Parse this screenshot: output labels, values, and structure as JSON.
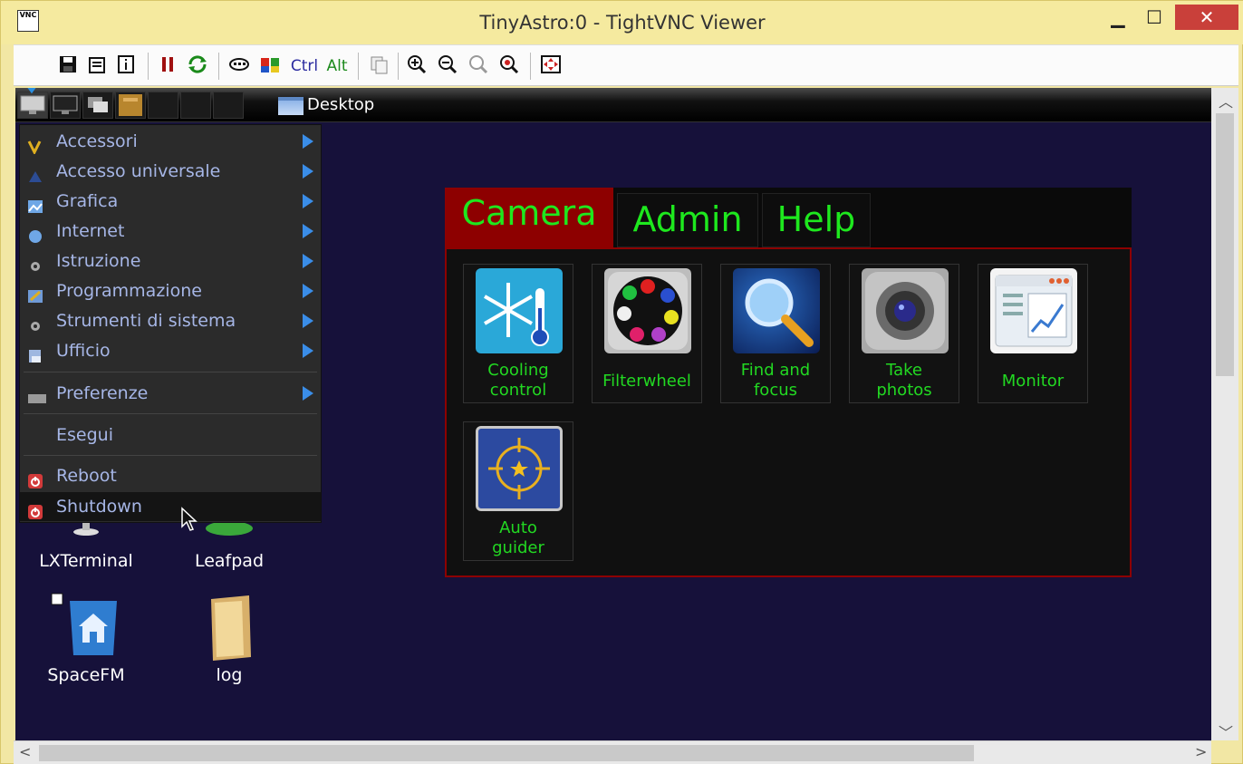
{
  "window": {
    "title": "TinyAstro:0 - TightVNC Viewer",
    "app_icon_text": "VNC",
    "minimize": "▁",
    "maximize": "☐",
    "close": "✕"
  },
  "toolbar": {
    "ctrl": "Ctrl",
    "alt": "Alt"
  },
  "panel": {
    "desktop_label": "Desktop"
  },
  "menu": {
    "items": [
      {
        "label": "Accessori",
        "icon": "accessories-icon",
        "color": "#e0b020",
        "submenu": true
      },
      {
        "label": "Accesso universale",
        "icon": "accessibility-icon",
        "color": "#4c72c4",
        "submenu": true
      },
      {
        "label": "Grafica",
        "icon": "graphics-icon",
        "color": "#6fa7e6",
        "submenu": true
      },
      {
        "label": "Internet",
        "icon": "internet-icon",
        "color": "#6fa7e6",
        "submenu": true
      },
      {
        "label": "Istruzione",
        "icon": "education-icon",
        "color": "#aaaaaa",
        "submenu": true
      },
      {
        "label": "Programmazione",
        "icon": "programming-icon",
        "color": "#6f9ad6",
        "submenu": true
      },
      {
        "label": "Strumenti di sistema",
        "icon": "system-tools-icon",
        "color": "#aaaaaa",
        "submenu": true
      },
      {
        "label": "Ufficio",
        "icon": "office-icon",
        "color": "#9fb7e0",
        "submenu": true
      },
      {
        "label": "Preferenze",
        "icon": "preferences-icon",
        "color": "#9a9a9a",
        "submenu": true
      },
      {
        "label": "Esegui",
        "icon": "",
        "color": "",
        "submenu": false
      },
      {
        "label": "Reboot",
        "icon": "power-icon",
        "color": "#d23a3a",
        "submenu": false
      },
      {
        "label": "Shutdown",
        "icon": "power-icon",
        "color": "#d23a3a",
        "submenu": false
      }
    ]
  },
  "desktop_icons": [
    {
      "label": "LXTerminal"
    },
    {
      "label": "Leafpad"
    },
    {
      "label": "SpaceFM"
    },
    {
      "label": "log"
    }
  ],
  "app": {
    "tabs": [
      "Camera",
      "Admin",
      "Help"
    ],
    "active_tab": "Camera",
    "tiles": [
      {
        "line1": "Cooling",
        "line2": "control",
        "icon": "snowflake-thermometer-icon"
      },
      {
        "line1": "Filterwheel",
        "line2": "",
        "icon": "filterwheel-icon"
      },
      {
        "line1": "Find and",
        "line2": "focus",
        "icon": "magnifier-icon"
      },
      {
        "line1": "Take",
        "line2": "photos",
        "icon": "camera-lens-icon"
      },
      {
        "line1": "Monitor",
        "line2": "",
        "icon": "monitor-chart-icon"
      },
      {
        "line1": "Auto",
        "line2": "guider",
        "icon": "crosshair-star-icon"
      }
    ],
    "accent": "#8d0000",
    "text_color": "#22d822"
  }
}
